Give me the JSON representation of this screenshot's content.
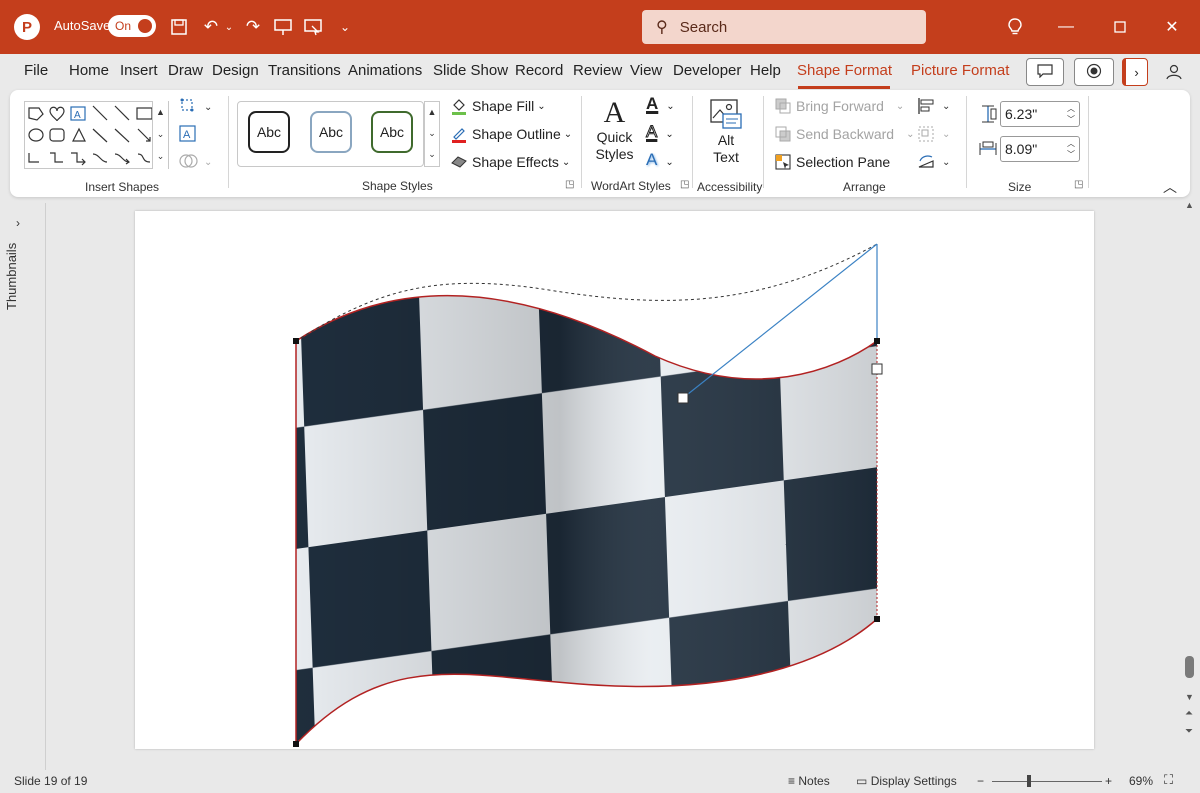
{
  "titlebar": {
    "autosave_label": "AutoSave",
    "autosave_state": "On",
    "search_placeholder": "Search",
    "app_logo": "P"
  },
  "menu_tabs": [
    "File",
    "Home",
    "Insert",
    "Draw",
    "Design",
    "Transitions",
    "Animations",
    "Slide Show",
    "Record",
    "Review",
    "View",
    "Developer",
    "Help",
    "Shape Format",
    "Picture Format"
  ],
  "ribbon": {
    "groups": {
      "insert_shapes": "Insert Shapes",
      "shape_styles": "Shape Styles",
      "wordart_styles": "WordArt Styles",
      "accessibility": "Accessibility",
      "arrange": "Arrange",
      "size": "Size"
    },
    "style_samples": [
      "Abc",
      "Abc",
      "Abc"
    ],
    "shape_fill": "Shape Fill",
    "shape_outline": "Shape Outline",
    "shape_effects": "Shape Effects",
    "quick_styles_line1": "Quick",
    "quick_styles_line2": "Styles",
    "alt_text_line1": "Alt",
    "alt_text_line2": "Text",
    "bring_forward": "Bring Forward",
    "send_backward": "Send Backward",
    "selection_pane": "Selection Pane",
    "height_value": "6.23\"",
    "width_value": "8.09\""
  },
  "panel": {
    "thumbnails_label": "Thumbnails"
  },
  "statusbar": {
    "slide_info": "Slide 19 of 19",
    "notes": "Notes",
    "display_settings": "Display Settings",
    "zoom": "69%"
  },
  "colors": {
    "accent": "#c43e1c",
    "shape_outline": "#b22222",
    "handle_line": "#3b82c4"
  }
}
